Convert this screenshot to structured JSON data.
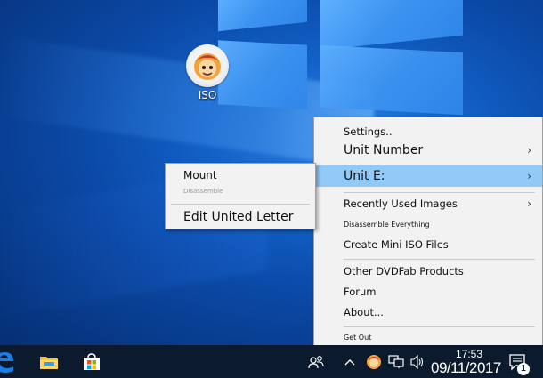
{
  "desktop": {
    "icon_label": "ISO"
  },
  "main_menu": {
    "items": [
      {
        "label": "Settings..",
        "size": "med"
      },
      {
        "label": "Unit Number",
        "size": "big",
        "submenu": true
      },
      {
        "label": "Unit E:",
        "size": "big",
        "submenu": true,
        "highlighted": true
      },
      {
        "label": "Recently Used Images",
        "size": "med",
        "submenu": true
      },
      {
        "label": "Disassemble Everything",
        "size": "small"
      },
      {
        "label": "Create Mini ISO Files",
        "size": "med"
      },
      {
        "label": "Other DVDFab Products",
        "size": "med"
      },
      {
        "label": "Forum",
        "size": "med"
      },
      {
        "label": "About...",
        "size": "med"
      },
      {
        "label": "Get Out",
        "size": "small"
      }
    ],
    "arrow_glyph": "›"
  },
  "sub_menu": {
    "mount": "Mount",
    "disassemble": "Disassemble",
    "edit_letter": "Edit United Letter"
  },
  "taskbar": {
    "clock_time": "17:53",
    "clock_date": "09/11/2017",
    "notification_count": "1",
    "colors": {
      "background": "#0b1a2d",
      "accent_highlight": "#91c9f7"
    }
  }
}
